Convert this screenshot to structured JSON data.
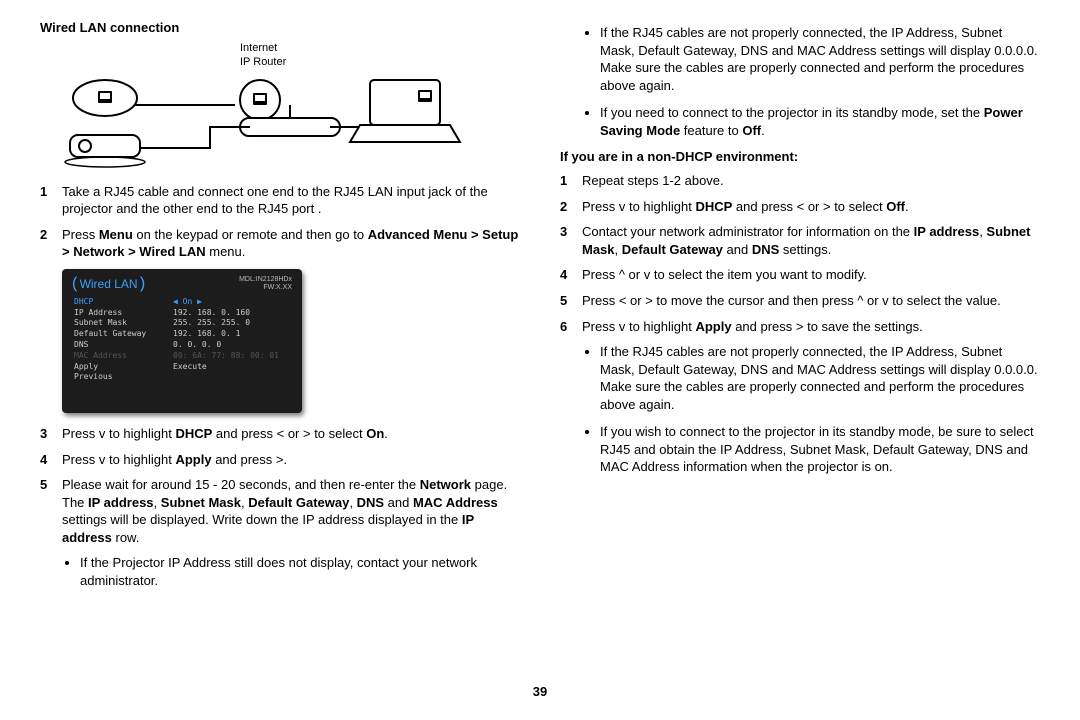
{
  "left": {
    "heading": "Wired LAN connection",
    "diagram": {
      "label_top": "Internet",
      "label_bottom": "IP Router"
    },
    "steps_a": [
      {
        "html": "Take a RJ45 cable and connect one end to the RJ45 LAN input jack of the projector and the other end to the RJ45 port ."
      },
      {
        "html": "Press <b>Menu</b> on the keypad or remote and then go to <b>Advanced Menu > Setup > Network > Wired LAN</b> menu."
      }
    ],
    "menu": {
      "title": "Wired LAN",
      "meta1": "MDL:IN2128HDx",
      "meta2": "FW:X.XX",
      "rows": [
        {
          "k": "DHCP",
          "v": "◀ On ▶",
          "cls": "active"
        },
        {
          "k": "IP Address",
          "v": "192. 168. 0. 160"
        },
        {
          "k": "Subnet Mask",
          "v": "255. 255. 255. 0"
        },
        {
          "k": "Default Gateway",
          "v": "192. 168. 0. 1"
        },
        {
          "k": "DNS",
          "v": "0. 0. 0. 0"
        },
        {
          "k": "MAC Address",
          "v": "00: 6A: 77: 88: 00: 01",
          "cls": "dim"
        },
        {
          "k": "Apply",
          "v": "Execute"
        },
        {
          "k": " ",
          "v": " "
        },
        {
          "k": "Previous",
          "v": ""
        }
      ]
    },
    "steps_b": [
      {
        "html": "Press v to highlight <b>DHCP</b> and press < or > to select <b>On</b>."
      },
      {
        "html": "Press v to highlight <b>Apply</b> and press >."
      },
      {
        "html": "Please wait for around 15 - 20 seconds, and then re-enter the <b>Network</b> page. The <b>IP address</b>, <b>Subnet Mask</b>, <b>Default Gateway</b>, <b>DNS</b> and <b>MAC Address</b> settings will be displayed. Write down the IP address displayed in the <b>IP address</b> row."
      }
    ],
    "bullet_bottom": "If the Projector IP Address still does not display, contact your network administrator."
  },
  "right": {
    "bullets_top": [
      "If the RJ45 cables are not properly connected, the IP Address, Subnet Mask, Default Gateway, DNS and MAC Address settings will display 0.0.0.0. Make sure the cables are properly connected and perform the procedures above again.",
      "If you need to connect to the projector in its standby mode, set the <b>Power Saving Mode</b> feature to <b>Off</b>."
    ],
    "subheading": "If you are in a non-DHCP environment:",
    "steps": [
      {
        "html": "Repeat steps 1-2 above."
      },
      {
        "html": "Press v to highlight <b>DHCP</b> and press < or > to select <b>Off</b>."
      },
      {
        "html": "Contact your network administrator for information on the <b>IP address</b>, <b>Subnet Mask</b>, <b>Default Gateway</b> and <b>DNS</b> settings."
      },
      {
        "html": "Press ^ or v to select the item you want to modify."
      },
      {
        "html": "Press < or > to move the cursor and then press ^ or v to select the value."
      },
      {
        "html": "Press v to highlight <b>Apply</b> and press > to save the settings."
      }
    ],
    "bullets_bottom": [
      "If the RJ45 cables are not properly connected, the IP Address, Subnet Mask, Default Gateway, DNS and MAC Address settings will display 0.0.0.0. Make sure the cables are properly connected and perform the procedures above again.",
      "If you wish to connect to the projector in its standby mode, be sure to select RJ45 and obtain the IP Address, Subnet Mask, Default Gateway, DNS and MAC Address information when the projector is on."
    ]
  },
  "page_number": "39"
}
